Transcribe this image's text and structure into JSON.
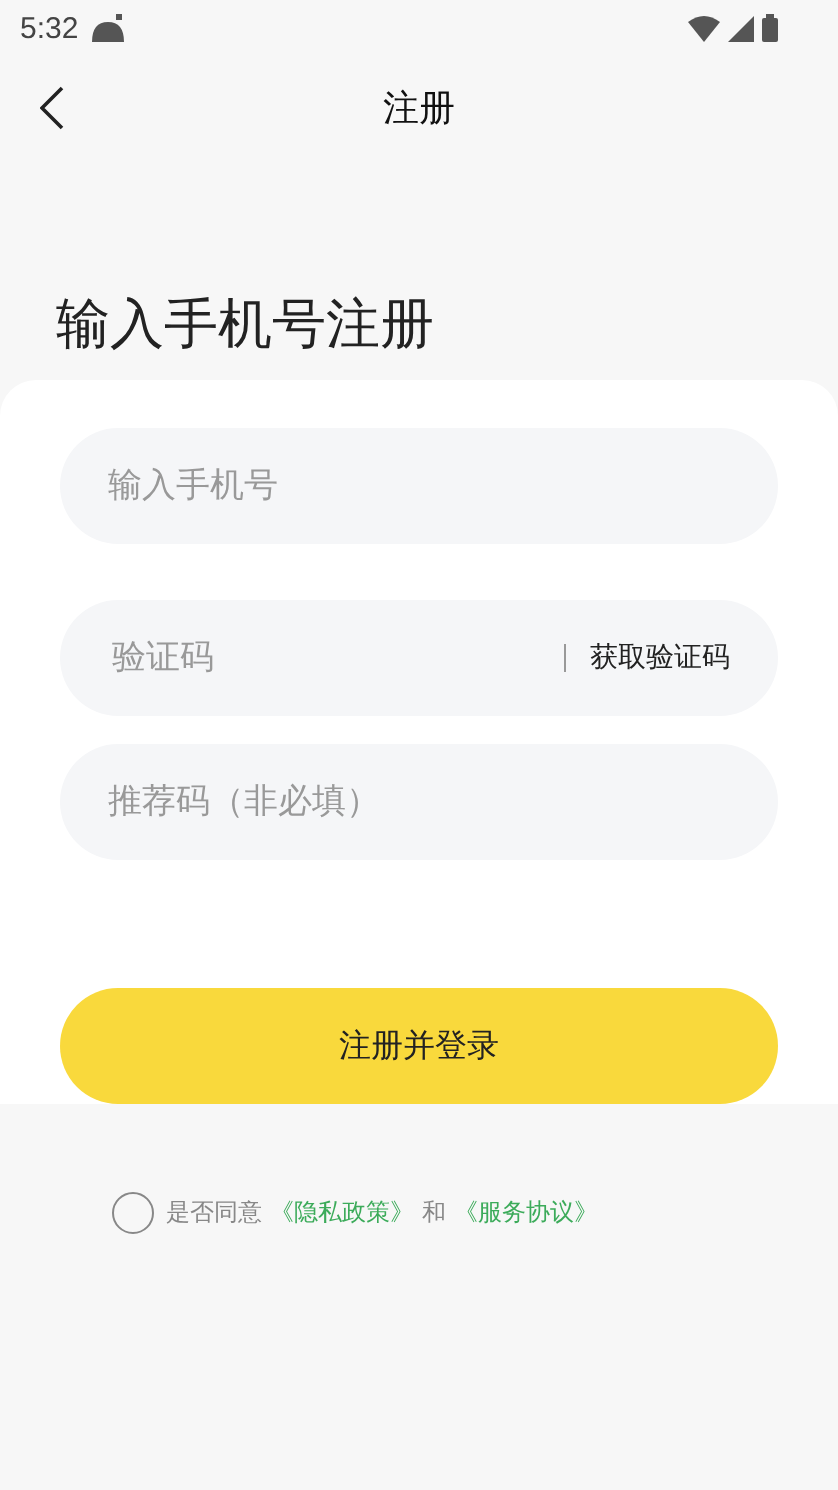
{
  "status_bar": {
    "time": "5:32"
  },
  "nav": {
    "title": "注册"
  },
  "heading": "输入手机号注册",
  "fields": [
    {
      "kind": "plain",
      "placeholder": "输入手机号"
    },
    {
      "kind": "code",
      "placeholder": "验证码",
      "action": "获取验证码"
    },
    {
      "kind": "plain",
      "placeholder": "推荐码（非必填）"
    }
  ],
  "submit": "注册并登录",
  "agreement": {
    "checked": false,
    "parts": [
      {
        "kind": "text",
        "text": "是否同意"
      },
      {
        "kind": "link",
        "text": "《隐私政策》"
      },
      {
        "kind": "text",
        "text": "和"
      },
      {
        "kind": "link",
        "text": "《服务协议》"
      }
    ]
  }
}
